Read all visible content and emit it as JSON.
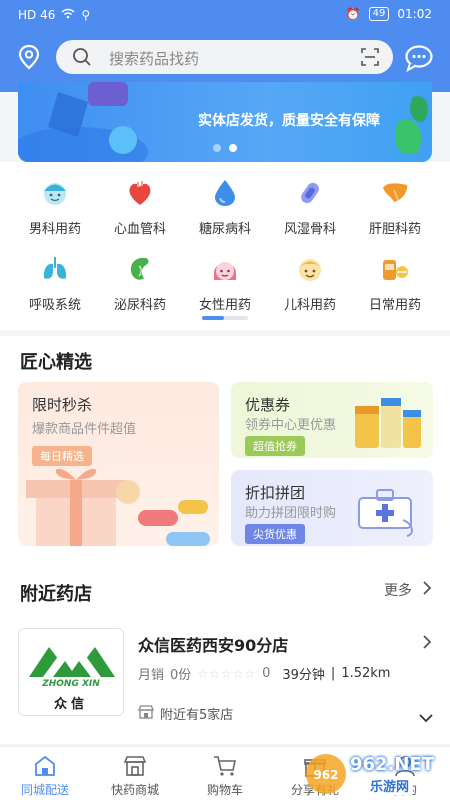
{
  "status": {
    "time": "01:02",
    "battery": "49",
    "left": "HD 46"
  },
  "search": {
    "placeholder": "搜索药品找药"
  },
  "banner": {
    "text": "实体店发货，质量安全有保障"
  },
  "categories": [
    {
      "label": "男科用药",
      "icon": "man-face-icon",
      "color": "#3bb3d8"
    },
    {
      "label": "心血管科",
      "icon": "heart-icon",
      "color": "#e8473d"
    },
    {
      "label": "糖尿病科",
      "icon": "drop-icon",
      "color": "#3d8ee8"
    },
    {
      "label": "风湿骨科",
      "icon": "bone-icon",
      "color": "#6a78e6"
    },
    {
      "label": "肝胆科药",
      "icon": "liver-icon",
      "color": "#f09a2c"
    },
    {
      "label": "呼吸系统",
      "icon": "lungs-icon",
      "color": "#3bb3d8"
    },
    {
      "label": "泌尿科药",
      "icon": "kidney-icon",
      "color": "#49b04c"
    },
    {
      "label": "女性用药",
      "icon": "woman-face-icon",
      "color": "#ef6f8d"
    },
    {
      "label": "儿科用药",
      "icon": "child-face-icon",
      "color": "#f3b23a"
    },
    {
      "label": "日常用药",
      "icon": "pill-icon",
      "color": "#f09a2c"
    }
  ],
  "select": {
    "title": "匠心精选",
    "flash": {
      "title": "限时秒杀",
      "sub": "爆款商品件件超值",
      "tag": "每日精选"
    },
    "coupon": {
      "title": "优惠券",
      "sub": "领券中心更优惠",
      "tag": "超值抢券"
    },
    "group": {
      "title": "折扣拼团",
      "sub": "助力拼团限时购",
      "tag": "尖货优惠"
    }
  },
  "nearby": {
    "title": "附近药店",
    "more": "更多",
    "shop": {
      "name": "众信医药西安90分店",
      "sales_label": "月销",
      "sales": "0份",
      "rating": "0",
      "time": "39分钟",
      "distance": "1.52km",
      "logo_text_top": "ZHONG XIN",
      "logo_text_cn": "众信"
    },
    "near_count": "附近有5家店"
  },
  "tabs": [
    {
      "label": "同城配送",
      "icon": "home-icon",
      "active": true
    },
    {
      "label": "快药商城",
      "icon": "shop-icon",
      "active": false
    },
    {
      "label": "购物车",
      "icon": "cart-icon",
      "active": false
    },
    {
      "label": "分享有礼",
      "icon": "gift-icon",
      "active": false
    },
    {
      "label": "我的",
      "icon": "user-icon",
      "active": false
    }
  ],
  "watermark": {
    "text1": "962.NET",
    "text2": "乐游网"
  },
  "colors": {
    "primary": "#4f8cf0"
  }
}
